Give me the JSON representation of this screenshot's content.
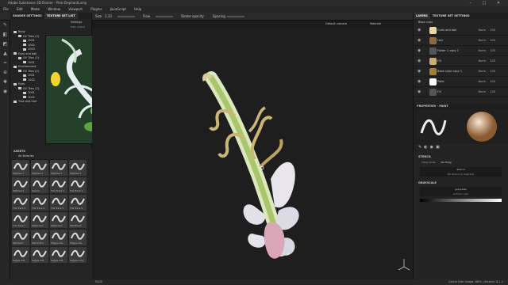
{
  "window": {
    "title": "Adobe Substance 3D Painter - Pink ElephantLump",
    "controls": [
      "–",
      "□",
      "✕"
    ]
  },
  "menu": [
    "File",
    "Edit",
    "Mode",
    "Window",
    "Viewport",
    "Plugins",
    "JavaScript",
    "Help"
  ],
  "toolbar": {
    "size": "1.33",
    "flow": "Flow",
    "stroke_opacity": "Stroke opacity",
    "spacing": "Spacing"
  },
  "left_tabs": {
    "shader_settings": "SHADER SETTINGS",
    "texture_set_list": "TEXTURE SET LIST",
    "settings": "Settings",
    "main_shader": "Main shader"
  },
  "texture_sets": [
    {
      "level": 1,
      "label": "Body"
    },
    {
      "level": 2,
      "label": "UV Tiles (3)"
    },
    {
      "level": 3,
      "label": "1001"
    },
    {
      "level": 3,
      "label": "1002"
    },
    {
      "level": 3,
      "label": "1003"
    },
    {
      "level": 1,
      "label": "Eyes and ball"
    },
    {
      "level": 2,
      "label": "UV Tiles (1)"
    },
    {
      "level": 3,
      "label": "1001"
    },
    {
      "level": 1,
      "label": "Environment"
    },
    {
      "level": 2,
      "label": "UV Tiles (2)"
    },
    {
      "level": 3,
      "label": "1001"
    },
    {
      "level": 3,
      "label": "1002"
    },
    {
      "level": 1,
      "label": "Eyes"
    },
    {
      "level": 2,
      "label": "UV Tiles (2)"
    },
    {
      "level": 3,
      "label": "1001"
    },
    {
      "level": 3,
      "label": "1002"
    },
    {
      "level": 1,
      "label": "Tusk and hair"
    }
  ],
  "assets": {
    "title": "ASSETS",
    "all_libraries": "All libraries",
    "search": "brush"
  },
  "brushes": [
    "Stitches 1",
    "Stitches 2",
    "Stitches 3",
    "Stitches 4",
    "Stitches 5",
    "Swarm",
    "Thin Track 1",
    "The Track 2",
    "The Track 3",
    "The Track 4",
    "The Track 5",
    "The Track 6",
    "The Track 7",
    "Watercolor",
    "Watercolor",
    "Wet Brush",
    "Wet Hard",
    "Wet Soft A",
    "Wiggle Tile",
    "Wiggle Tile",
    "Wiggle Tile",
    "Wiggle Tile",
    "Wiggle Tile",
    "Wiggle Long"
  ],
  "viewport": {
    "camera": "Default camera",
    "mode": "Material"
  },
  "layers_panel": {
    "tabs": [
      "LAYERS",
      "TEXTURE SET SETTINGS"
    ],
    "blend": "Base color",
    "layers": [
      {
        "name": "Curls and ball",
        "blend": "Norm",
        "opacity": "100",
        "color": "#e8d7a8"
      },
      {
        "name": "Hair",
        "blend": "Norm",
        "opacity": "100",
        "color": "#8c6a3a"
      },
      {
        "name": "Folder 1 copy 1",
        "blend": "Norm",
        "opacity": "100",
        "color": "#555555"
      },
      {
        "name": "Fill",
        "blend": "Norm",
        "opacity": "100",
        "color": "#c9b069"
      },
      {
        "name": "Base color copy 1",
        "blend": "Norm",
        "opacity": "100",
        "color": "#a07e3c"
      },
      {
        "name": "Paint",
        "blend": "Norm",
        "opacity": "100",
        "color": "#ffffff"
      },
      {
        "name": "Fill",
        "blend": "Norm",
        "opacity": "100",
        "color": "#555555"
      }
    ]
  },
  "properties": {
    "title": "PROPERTIES - PAINT",
    "stencil_section": "STENCIL",
    "tiling_label": "Tiling mode",
    "tiling_value": "No Tiling",
    "stencil_label": "Stencil",
    "stencil_value": "No Resource Selected",
    "grayscale_section": "GRAYSCALE",
    "grayscale_label": "grayscale",
    "grayscale_value": "uniform color"
  },
  "status": {
    "left": "PAGE",
    "right": "Cache Disk Usage:  88%  |  Version: 8.1.1"
  }
}
